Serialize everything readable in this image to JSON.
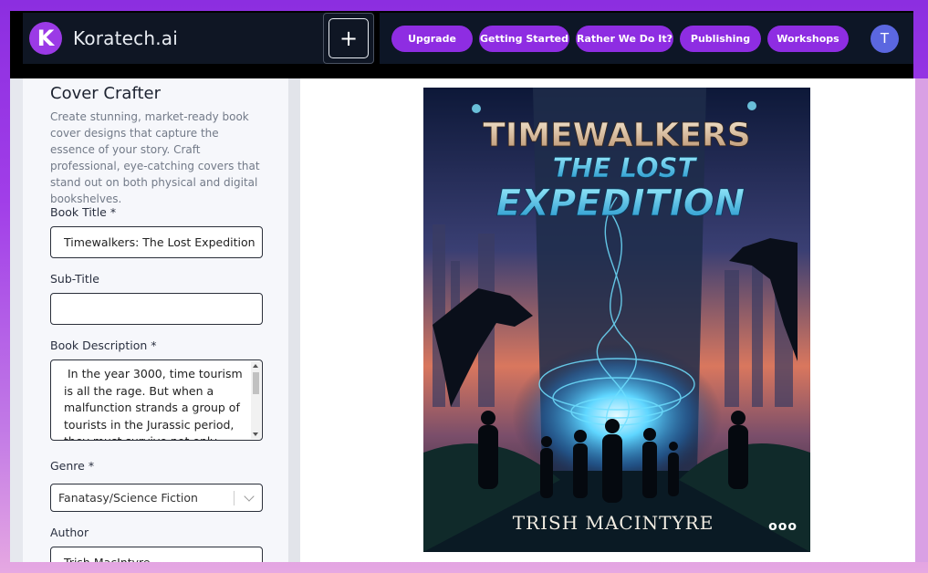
{
  "app": {
    "brand_name": "Koratech.ai",
    "logo_letter": "K",
    "new_button_glyph": "+"
  },
  "nav": {
    "items": [
      {
        "label": "Upgrade"
      },
      {
        "label": "Getting Started"
      },
      {
        "label": "Rather We Do It?"
      },
      {
        "label": "Publishing"
      },
      {
        "label": "Workshops"
      }
    ],
    "avatar_initial": "T"
  },
  "panel": {
    "title": "Cover Crafter",
    "description": "Create stunning, market-ready book cover designs that capture the essence of your story. Craft professional, eye-catching covers that stand out on both physical and digital bookshelves.",
    "book_title": {
      "label": "Book Title *",
      "value": "Timewalkers: The Lost Expedition"
    },
    "sub_title": {
      "label": "Sub-Title",
      "value": ""
    },
    "book_description": {
      "label": "Book Description *",
      "value": "In the year 3000, time tourism is all the rage. But when a malfunction strands a group of tourists in the Jurassic period, they must survive not only from"
    },
    "genre": {
      "label": "Genre *",
      "value": "Fanatasy/Science Fiction"
    },
    "author": {
      "label": "Author",
      "value": "Trish MacIntyre"
    }
  },
  "cover": {
    "title_line1": "TIMEWALKERS",
    "title_line2": "THE LOST",
    "title_line3": "EXPEDITION",
    "author": "TRISH MACINTYRE",
    "menu_glyph": "ooo"
  },
  "colors": {
    "accent": "#8e2de2",
    "avatar": "#5b67e0",
    "header_bg": "#0f1624"
  }
}
